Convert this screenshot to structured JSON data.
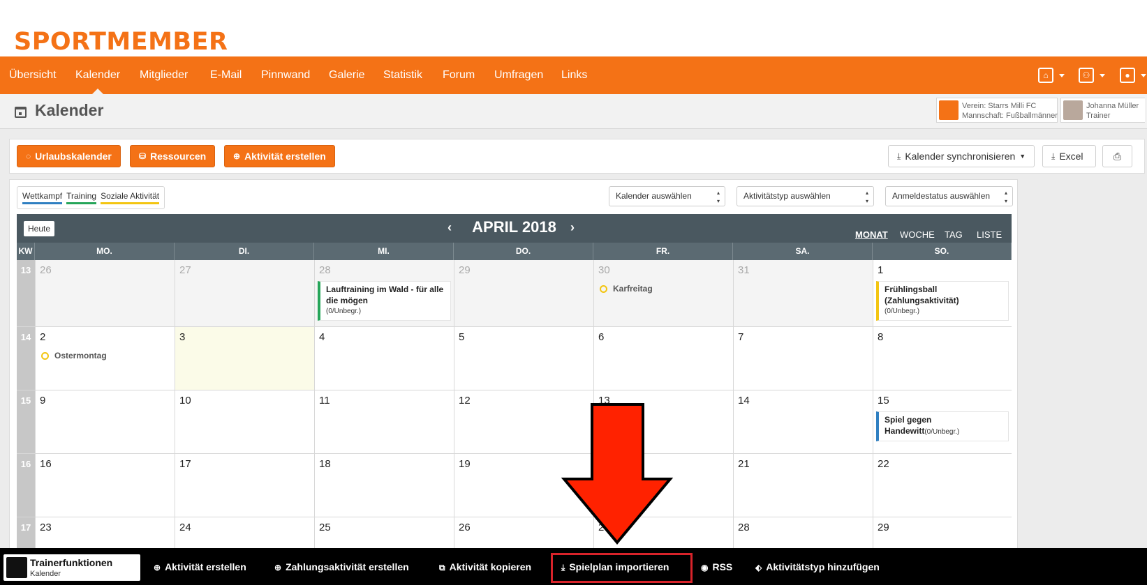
{
  "logo": "SPORTMEMBER",
  "nav": {
    "items": [
      "Übersicht",
      "Kalender",
      "Mitglieder",
      "E-Mail",
      "Pinnwand",
      "Galerie",
      "Statistik",
      "Forum",
      "Umfragen",
      "Links"
    ],
    "active": "Kalender"
  },
  "page": {
    "title": "Kalender",
    "club_line1": "Verein: Starrs Milli FC",
    "club_line2": "Mannschaft: Fußballmänner",
    "user_line1": "Johanna Müller",
    "user_line2": "Trainer"
  },
  "actions": {
    "vacation": "Urlaubskalender",
    "resources": "Ressourcen",
    "create": "Aktivität erstellen",
    "sync": "Kalender synchronisieren",
    "excel": "Excel"
  },
  "legend": [
    {
      "label": "Wettkampf",
      "color": "#2f7fc1"
    },
    {
      "label": "Training",
      "color": "#25a559"
    },
    {
      "label": "Soziale Aktivität",
      "color": "#f3c511"
    }
  ],
  "filters": {
    "calendar": "Kalender auswählen",
    "type": "Aktivitätstyp auswählen",
    "status": "Anmeldestatus auswählen"
  },
  "calendar": {
    "today_button": "Heute",
    "month_title": "APRIL 2018",
    "views": [
      "MONAT",
      "WOCHE",
      "TAG",
      "LISTE"
    ],
    "active_view": "MONAT",
    "kw_label": "KW",
    "weekdays": [
      "MO.",
      "DI.",
      "MI.",
      "DO.",
      "FR.",
      "SA.",
      "SO."
    ],
    "weeks": [
      {
        "kw": "13",
        "days": [
          {
            "n": "26",
            "other": true
          },
          {
            "n": "27",
            "other": true
          },
          {
            "n": "28",
            "other": true,
            "event": {
              "title": "Lauftraining im Wald - für alle die mögen",
              "sub": "(0/Unbegr.)",
              "color": "#25a559"
            }
          },
          {
            "n": "29",
            "other": true
          },
          {
            "n": "30",
            "other": true,
            "holiday": "Karfreitag"
          },
          {
            "n": "31",
            "other": true
          },
          {
            "n": "1",
            "event": {
              "title": "Frühlingsball (Zahlungsaktivität)",
              "sub": "(0/Unbegr.)",
              "color": "#f3c511"
            }
          }
        ]
      },
      {
        "kw": "14",
        "days": [
          {
            "n": "2",
            "holiday": "Ostermontag"
          },
          {
            "n": "3",
            "today": true
          },
          {
            "n": "4"
          },
          {
            "n": "5"
          },
          {
            "n": "6"
          },
          {
            "n": "7"
          },
          {
            "n": "8"
          }
        ]
      },
      {
        "kw": "15",
        "days": [
          {
            "n": "9"
          },
          {
            "n": "10"
          },
          {
            "n": "11"
          },
          {
            "n": "12"
          },
          {
            "n": "13"
          },
          {
            "n": "14"
          },
          {
            "n": "15",
            "event": {
              "title": "Spiel gegen Handewitt",
              "sub": "(0/Unbegr.)",
              "color": "#2f7fc1",
              "inline": true
            }
          }
        ]
      },
      {
        "kw": "16",
        "days": [
          {
            "n": "16"
          },
          {
            "n": "17"
          },
          {
            "n": "18"
          },
          {
            "n": "19"
          },
          {
            "n": "20"
          },
          {
            "n": "21"
          },
          {
            "n": "22"
          }
        ]
      },
      {
        "kw": "17",
        "days": [
          {
            "n": "23"
          },
          {
            "n": "24"
          },
          {
            "n": "25"
          },
          {
            "n": "26"
          },
          {
            "n": "27"
          },
          {
            "n": "28"
          },
          {
            "n": "29"
          }
        ]
      }
    ]
  },
  "footer": {
    "title": "Trainerfunktionen",
    "subtitle": "Kalender",
    "items": [
      {
        "label": "Aktivität erstellen",
        "icon": "plus-circle-icon"
      },
      {
        "label": "Zahlungsaktivität erstellen",
        "icon": "plus-circle-icon"
      },
      {
        "label": "Aktivität kopieren",
        "icon": "copy-icon"
      },
      {
        "label": "Spielplan importieren",
        "icon": "download-icon"
      },
      {
        "label": "RSS",
        "icon": "rss-icon"
      },
      {
        "label": "Aktivitätstyp hinzufügen",
        "icon": "tag-icon"
      }
    ]
  },
  "colors": {
    "brand": "#f47216",
    "header_dark": "#4a5860",
    "highlight_red": "#d8232a",
    "arrow_red": "#ff2200"
  }
}
